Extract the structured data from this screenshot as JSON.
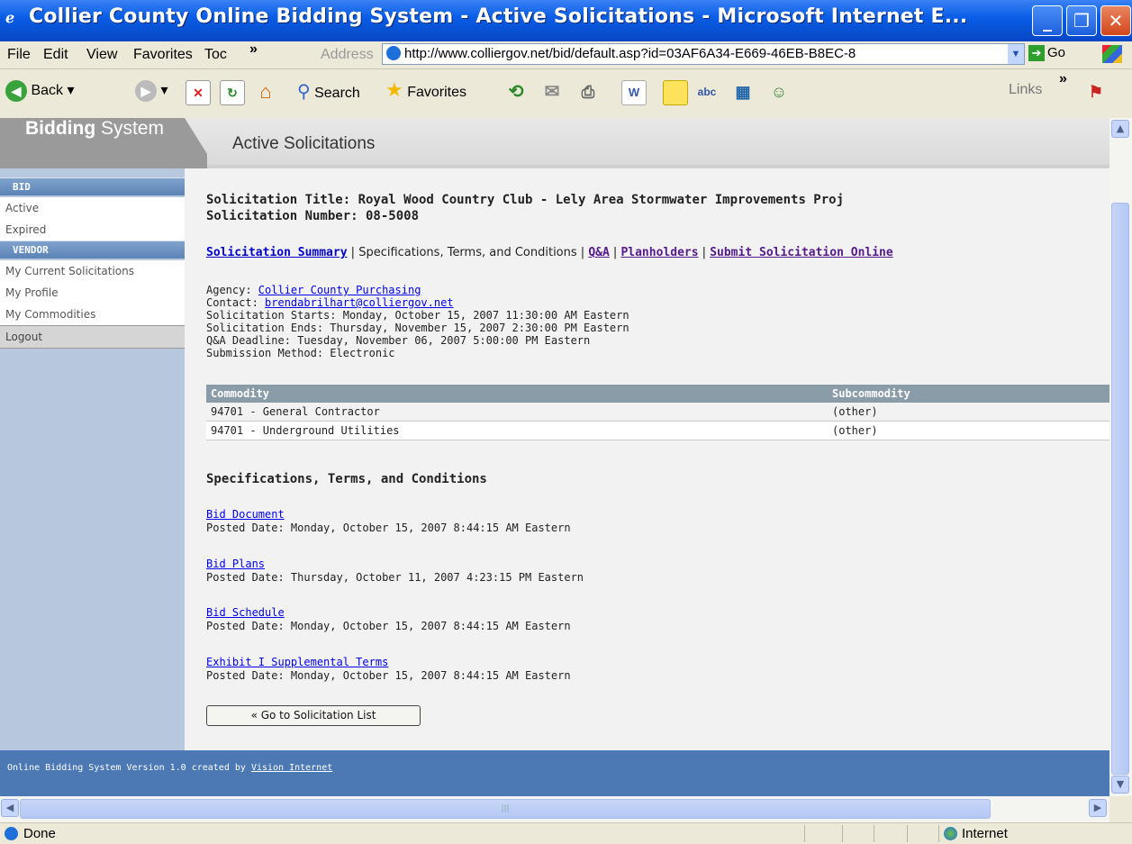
{
  "window": {
    "title": "Collier County Online Bidding System - Active Solicitations - Microsoft Internet E...",
    "minimize": "_",
    "maximize": "❐",
    "close": "✕"
  },
  "menubar": {
    "items": [
      "File",
      "Edit",
      "View",
      "Favorites",
      "Toc"
    ],
    "overflow": "»",
    "address_label": "Address",
    "address_url": "http://www.colliergov.net/bid/default.asp?id=03AF6A34-E669-46EB-B8EC-8",
    "go_label": "Go"
  },
  "toolbar": {
    "back_label": "Back",
    "search_label": "Search",
    "favorites_label": "Favorites",
    "links_label": "Links",
    "overflow": "»"
  },
  "site": {
    "logo_bold": "Bidding",
    "logo_light": " System",
    "page_heading": "Active Solicitations"
  },
  "sidebar": {
    "bid_heading": "BID",
    "bid_items": [
      "Active",
      "Expired"
    ],
    "vendor_heading": "VENDOR",
    "vendor_items": [
      "My Current Solicitations",
      "My Profile",
      "My Commodities"
    ],
    "logout": "Logout"
  },
  "solicitation": {
    "title": "Solicitation Title: Royal Wood Country Club - Lely Area Stormwater Improvements Proj",
    "number": "Solicitation Number: 08-5008",
    "tabs": {
      "summary": "Solicitation Summary",
      "sep": " | ",
      "specs": "Specifications, Terms, and Conditions",
      "qa": "Q&A",
      "planholders": "Planholders",
      "submit": "Submit Solicitation Online"
    },
    "agency_label": "Agency: ",
    "agency": "Collier County Purchasing",
    "contact_label": "Contact: ",
    "contact": "brendabrilhart@colliergov.net",
    "starts": "Solicitation Starts: Monday, October 15, 2007 11:30:00 AM Eastern",
    "ends": "Solicitation Ends: Thursday, November 15, 2007 2:30:00 PM Eastern",
    "qa_deadline": "Q&A Deadline: Tuesday, November 06, 2007 5:00:00 PM Eastern",
    "method": "Submission Method: Electronic"
  },
  "commodities": {
    "headers": [
      "Commodity",
      "Subcommodity"
    ],
    "rows": [
      [
        "94701 - General Contractor",
        "(other)"
      ],
      [
        "94701 - Underground Utilities",
        "(other)"
      ]
    ]
  },
  "specs": {
    "heading": "Specifications, Terms, and Conditions",
    "documents": [
      {
        "name": "Bid Document",
        "posted": "Posted Date: Monday, October 15, 2007 8:44:15 AM Eastern"
      },
      {
        "name": "Bid Plans",
        "posted": "Posted Date: Thursday, October 11, 2007 4:23:15 PM Eastern"
      },
      {
        "name": "Bid Schedule",
        "posted": "Posted Date: Monday, October 15, 2007 8:44:15 AM Eastern"
      },
      {
        "name": "Exhibit I Supplemental Terms",
        "posted": "Posted Date: Monday, October 15, 2007 8:44:15 AM Eastern"
      }
    ],
    "back_button": "« Go to Solicitation List"
  },
  "footer": {
    "text": "Online Bidding System Version 1.0 created by ",
    "link": "Vision Internet"
  },
  "status": {
    "text": "Done",
    "zone": "Internet"
  }
}
